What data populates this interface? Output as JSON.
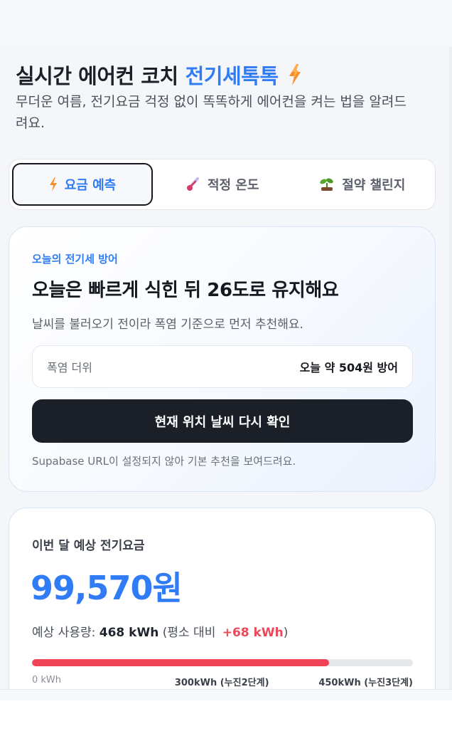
{
  "header": {
    "title": "실시간 에어컨 코치",
    "brand": "전기세톡톡",
    "subtitle": "무더운 여름, 전기요금 걱정 없이 똑똑하게 에어컨을 켜는 법을 알려드려요."
  },
  "tabs": [
    {
      "label": "요금 예측",
      "icon": "lightning-icon",
      "active": true
    },
    {
      "label": "적정 온도",
      "icon": "thermometer-icon",
      "active": false
    },
    {
      "label": "절약 챌린지",
      "icon": "sprout-icon",
      "active": false
    }
  ],
  "defense": {
    "eyebrow": "오늘의 전기세 방어",
    "headline": "오늘은 빠르게 식힌 뒤 26도로 유지해요",
    "description": "날씨를 불러오기 전이라 폭염 기준으로 먼저 추천해요.",
    "weather_label": "폭염 더위",
    "saving_text": "오늘 약 504원 방어",
    "refresh_button": "현재 위치 날씨 다시 확인",
    "note": "Supabase URL이 설정되지 않아 기본 추천을 보여드려요."
  },
  "bill": {
    "label": "이번 달 예상 전기요금",
    "amount": "99,570원",
    "usage_prefix": "예상 사용량: ",
    "usage_value": "468 kWh",
    "usage_mid": " (평소 대비 ",
    "usage_diff": "+68 kWh",
    "usage_suffix": ")",
    "progress_fraction": 0.78,
    "ticks": [
      "0 kWh",
      "300kWh (누진2단계)",
      "450kWh (누진3단계)"
    ]
  },
  "colors": {
    "accent": "#2f7cf6",
    "danger": "#ef4456",
    "dark": "#1b1f27"
  }
}
